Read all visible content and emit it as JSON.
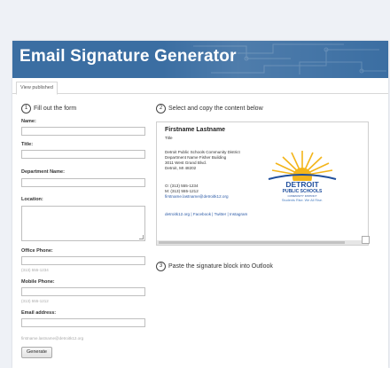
{
  "header": {
    "title": "Email Signature Generator"
  },
  "tabs": [
    {
      "label": "View published"
    }
  ],
  "steps": [
    {
      "num": "1",
      "label": "Fill out the form"
    },
    {
      "num": "2",
      "label": "Select and copy the content below"
    },
    {
      "num": "3",
      "label": "Paste the signature block into Outlook"
    }
  ],
  "form": {
    "name_label": "Name:",
    "title_label": "Title:",
    "department_label": "Department Name:",
    "location_label": "Location:",
    "office_phone_label": "Office Phone:",
    "office_phone_hint": "(313) 555-1234",
    "mobile_phone_label": "Mobile Phone:",
    "mobile_phone_hint": "(313) 555-1212",
    "email_label": "Email address:",
    "email_hint": "firstname.lastname@detroitk12.org",
    "generate_label": "Generate"
  },
  "signature": {
    "name": "Firstname Lastname",
    "title": "Title",
    "lines": [
      "Detroit Public Schools Community District",
      "Department Name Fisher Building",
      "3011 West Grand Blvd.",
      "Detroit, MI 48202"
    ],
    "office": "O: (313) 555-1234",
    "mobile": "M: (313) 555-1212",
    "email": "firstname.lastname@detroitk12.org",
    "links": "detroitk12.org | Facebook | Twitter | Instagram",
    "logo": {
      "line1": "DETROIT",
      "line2": "PUBLIC SCHOOLS",
      "line3": "COMMUNITY DISTRICT",
      "tagline": "Students Rise. We All Rise."
    }
  },
  "colors": {
    "banner": "#3b6ea2",
    "logo_blue": "#1f4e9c",
    "sun": "#f3b51b"
  }
}
